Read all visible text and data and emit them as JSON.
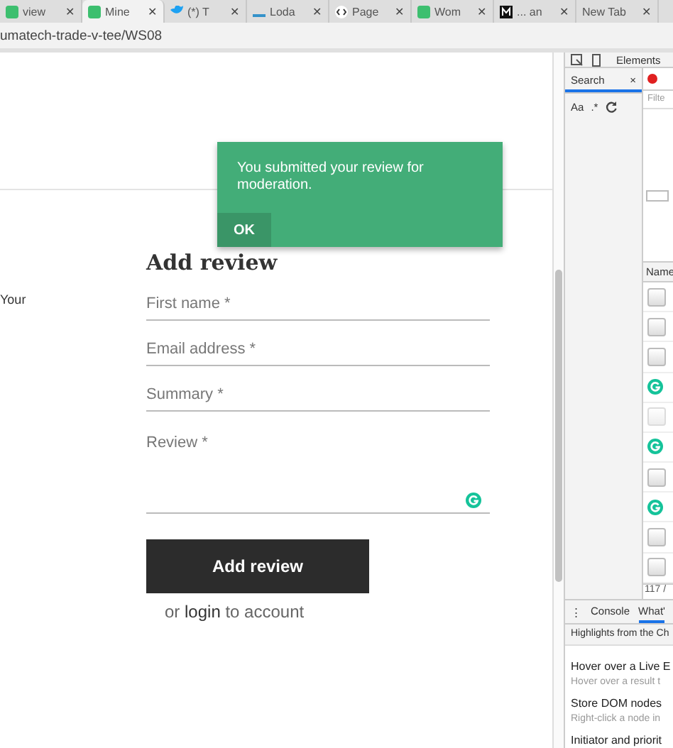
{
  "browser_tabs": [
    {
      "title": "view",
      "kind": "green",
      "close": "✕",
      "selected": false
    },
    {
      "title": "Mine",
      "kind": "green",
      "close": "✕",
      "selected": true
    },
    {
      "title": "(*) T",
      "kind": "bird",
      "close": "✕",
      "selected": false
    },
    {
      "title": "Loda",
      "kind": "dash",
      "close": "✕",
      "selected": false
    },
    {
      "title": "Page",
      "kind": "code",
      "close": "✕",
      "selected": false
    },
    {
      "title": "Wom",
      "kind": "green",
      "close": "✕",
      "selected": false
    },
    {
      "title": "... an",
      "kind": "m",
      "close": "✕",
      "selected": false
    },
    {
      "title": "New Tab",
      "kind": "plain",
      "close": "✕",
      "selected": false
    }
  ],
  "address_bar": {
    "url": "umatech-trade-v-tee/WS08"
  },
  "page": {
    "side_text": "Your",
    "heading": "Add review",
    "fields": [
      {
        "placeholder": "First name *",
        "kind": "line"
      },
      {
        "placeholder": "Email address *",
        "kind": "line"
      },
      {
        "placeholder": "Summary *",
        "kind": "line"
      },
      {
        "placeholder": "Review *",
        "kind": "area"
      }
    ],
    "submit_button": "Add review",
    "login_prefix": "or",
    "login_link": "login",
    "login_suffix": "to account"
  },
  "toast": {
    "message": "You submitted your review for moderation.",
    "button": "OK"
  },
  "devtools": {
    "top_tab": "Elements",
    "search_tab": {
      "label": "Search",
      "selected": true
    },
    "close": "×",
    "search_options": [
      "Aa",
      ".*"
    ],
    "filter_placeholder": "Filte",
    "name_header": "Name",
    "requests": [
      {
        "kind": "square"
      },
      {
        "kind": "square"
      },
      {
        "kind": "square"
      },
      {
        "kind": "grammarly"
      },
      {
        "kind": "faint"
      },
      {
        "kind": "grammarly"
      },
      {
        "kind": "square"
      },
      {
        "kind": "grammarly"
      },
      {
        "kind": "square"
      },
      {
        "kind": "square"
      }
    ],
    "request_count": "117 /",
    "drawer_tabs": [
      {
        "label": "Console",
        "selected": false
      },
      {
        "label": "What'",
        "selected": true
      }
    ],
    "drawer_menu": "⋮",
    "highlights_title": "Highlights from the Ch",
    "tips": [
      {
        "title": "Hover over a Live E",
        "text": "Hover over a result t"
      },
      {
        "title": "Store DOM nodes",
        "text": "Right-click a node in"
      },
      {
        "title": "Initiator and priorit"
      }
    ]
  }
}
